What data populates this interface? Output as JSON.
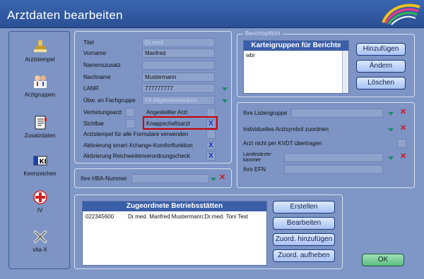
{
  "window": {
    "title": "Arztdaten bearbeiten"
  },
  "sidebar": {
    "items": [
      {
        "label": "Arztstempel",
        "icon": "stamp-icon"
      },
      {
        "label": "Arztgruppen",
        "icon": "doctors-icon"
      },
      {
        "label": "Zusatzdaten",
        "icon": "notebook-icon"
      },
      {
        "label": "Kennzeichen",
        "icon": "ki-badge-icon"
      },
      {
        "label": "IV",
        "icon": "medical-cross-icon"
      },
      {
        "label": "vita-X",
        "icon": "vitax-icon"
      }
    ]
  },
  "form": {
    "titel_label": "Titel",
    "titel_value": "Dr.med",
    "vorname_label": "Vorname",
    "vorname_value": "Manfred",
    "namenszusatz_label": "Namenszusatz",
    "namenszusatz_value": "",
    "nachname_label": "Nachname",
    "nachname_value": "Mustermann",
    "lanr_label": "LANR",
    "lanr_value": "777777777",
    "fachgruppe_label": "Übw. an Fachgruppe",
    "fachgruppe_value": "FA Allgemeinmedizin",
    "vertretungsarzt_label": "Vertretungsarzt",
    "angestellter_label": "Angestellter Arzt",
    "sichtbar_label": "Sichtbar",
    "knappschaft_label": "Knappschaftsarzt",
    "knappschaft_check": "X",
    "arztstempel_all_label": "Arztstempel für alle Formulare verwenden",
    "smartx_label": "Aktivierung smart-Xchange-Komfortfunktion",
    "smartx_check": "X",
    "reichweite_label": "Aktivierung Reichweitenverordnungscheck",
    "reichweite_check": "X"
  },
  "hba": {
    "label": "Ihre HBA-Nummer"
  },
  "berichtspflicht": {
    "legend": "Berichtspflicht",
    "list_header": "Karteigruppen für Berichte",
    "items": [
      "wbr"
    ],
    "btn_add": "Hinzufügen",
    "btn_change": "Ändern",
    "btn_delete": "Löschen"
  },
  "right": {
    "listengruppe_label": "Ihre Listengruppe",
    "arztsymbol_label": "Individuelles Arztsymbol zuordnen",
    "kvdt_label": "Arzt nicht per KVDT übertragen",
    "kammer_label_1": "Landesärzte-",
    "kammer_label_2": "kammer",
    "efn_label": "Ihre EFN"
  },
  "betrieb": {
    "header": "Zugeordnete Betriebsstätten",
    "rows": [
      {
        "id": "022345600",
        "names": "Dr.med. Manfred Mustermann;Dr.med. Toni Test"
      }
    ],
    "btn_create": "Erstellen",
    "btn_edit": "Bearbeiten",
    "btn_assign": "Zuord. hinzufügen",
    "btn_unassign": "Zuord. aufheben"
  },
  "ok_label": "OK"
}
